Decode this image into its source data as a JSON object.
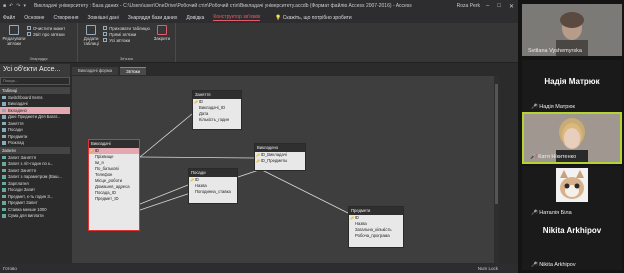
{
  "window": {
    "title": "Викладачі університету : База даних - C:\\Users\\user\\OneDrive\\Робочий стіл\\Робочий стіл\\Викладачі університету.accdb (Формат файлів Access 2007-2016) - Access",
    "user": "Roza Perk",
    "app": "Access"
  },
  "menu": {
    "tabs": [
      "Файл",
      "Основне",
      "Створення",
      "Зовнішні дані",
      "Знаряддя бази даних",
      "Довідка",
      "Конструктор зв'язків"
    ],
    "active_tab": "Конструктор зв'язків",
    "tell_me": "Скажіть, що потрібно зробити"
  },
  "ribbon": {
    "edit_relationships": "Редагувати зв'язки",
    "clear_layout": "Очистити макет",
    "relationship_report": "Звіт про зв'язки",
    "tools_group": "Знаряддя",
    "add_tables": "Додати таблиці",
    "hide_table": "Приховати таблицю",
    "direct_relationships": "Прямі зв'язки",
    "all_relationships": "Усі зв'язки",
    "close": "Закрити",
    "relationships_group": "Зв'язки"
  },
  "nav": {
    "header": "Усі об'єкти Acce...",
    "search_placeholder": "Пошук...",
    "sections": {
      "tables": "Таблиці",
      "queries": "Запити"
    },
    "tables": [
      "Switchboard Items",
      "Викладачі",
      "Вкладено",
      "Дані Предмети Для Багат...",
      "Заняття",
      "Посади",
      "Предмети",
      "Розклад"
    ],
    "selected_table": "Вкладено",
    "queries": [
      "Запит Заняття",
      "Запит з літ-годин по к...",
      "Запит Заняття",
      "Запит з параметром (Ваш...",
      "Зарплатня",
      "Посади Запит",
      "Предмет, к-ть годин З...",
      "Предмет Запит",
      "Ставка менше 1000",
      "Сума для виплати"
    ]
  },
  "doc_tabs": [
    "Викладачі форма",
    "Зв'язки"
  ],
  "active_doc_tab": "Зв'язки",
  "tables": {
    "vykladachi": {
      "title": "Викладачі",
      "fields": [
        "ID",
        "Прізвище",
        "Ім_я",
        "По_батькові",
        "Телефон",
        "Місце_роботи",
        "Домашня_адреса",
        "Посада_ID",
        "Предмет_ID"
      ]
    },
    "zaniattia": {
      "title": "Заняття",
      "fields": [
        "ID",
        "Викладачі_ID",
        "Дата",
        "Кількість_годин"
      ]
    },
    "vykladeno": {
      "title": "Викладено",
      "fields": [
        "ID_Викладачі",
        "ID_Предметы"
      ]
    },
    "posady": {
      "title": "Посади",
      "fields": [
        "ID",
        "Назва",
        "Погодинна_ставка"
      ]
    },
    "predmety": {
      "title": "Предмети",
      "fields": [
        "ID",
        "Назва",
        "Загальна_кількість",
        "Робоча_програма"
      ]
    }
  },
  "status": {
    "left": "Готово",
    "right": "Num Lock"
  },
  "participants": [
    {
      "name": "Svitlana Vyshemyrska",
      "kind": "video",
      "muted": false
    },
    {
      "name": "Надія Матрюк",
      "kind": "name",
      "muted": true
    },
    {
      "name": "Катя Нікитенко",
      "kind": "video",
      "muted": true,
      "active": true
    },
    {
      "name": "Наталія Біла",
      "kind": "avatar-cat",
      "muted": true
    },
    {
      "name": "Nikita Arkhipov",
      "kind": "name",
      "muted": true
    }
  ],
  "colors": {
    "accent": "#e35a6a",
    "highlight_border": "#dd3333",
    "active_speaker": "#b6d335",
    "selected_row": "#e3a8b0"
  }
}
